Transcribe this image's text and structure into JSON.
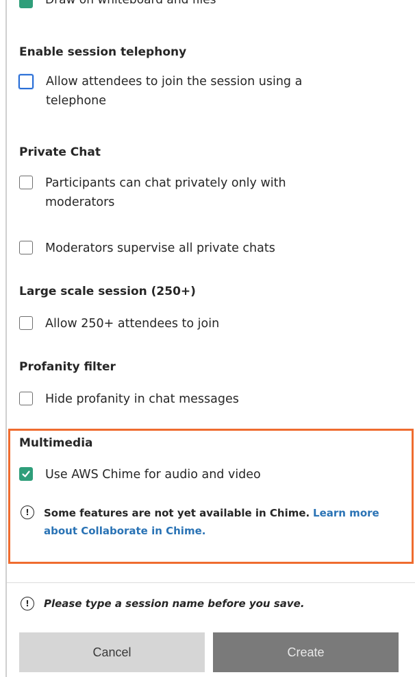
{
  "top_cut_item": {
    "label": "Draw on whiteboard and files",
    "checked": true
  },
  "sections": {
    "telephony": {
      "title": "Enable session telephony",
      "options": [
        {
          "label_line1": "Allow attendees to join the session using a",
          "label_line2": "telephone",
          "checked": false,
          "focused": true
        }
      ]
    },
    "private_chat": {
      "title": "Private Chat",
      "options": [
        {
          "label_line1": "Participants can chat privately only with",
          "label_line2": "moderators",
          "checked": false
        },
        {
          "label": "Moderators supervise all private chats",
          "checked": false
        }
      ]
    },
    "large_scale": {
      "title": "Large scale session (250+)",
      "options": [
        {
          "label": "Allow 250+ attendees to join",
          "checked": false
        }
      ]
    },
    "profanity": {
      "title": "Profanity filter",
      "options": [
        {
          "label": "Hide profanity in chat messages",
          "checked": false
        }
      ]
    },
    "multimedia": {
      "title": "Multimedia",
      "options": [
        {
          "label": "Use AWS Chime for audio and video",
          "checked": true
        }
      ],
      "info_text": "Some features are not yet available in Chime.",
      "info_link_line1": "Learn more",
      "info_link_line2": "about Collaborate in Chime."
    }
  },
  "footer": {
    "note": "Please type a session name before you save.",
    "cancel_label": "Cancel",
    "create_label": "Create"
  },
  "colors": {
    "accent_check": "#2f9e7a",
    "highlight_border": "#ef6c2f",
    "link": "#2a73b5"
  }
}
